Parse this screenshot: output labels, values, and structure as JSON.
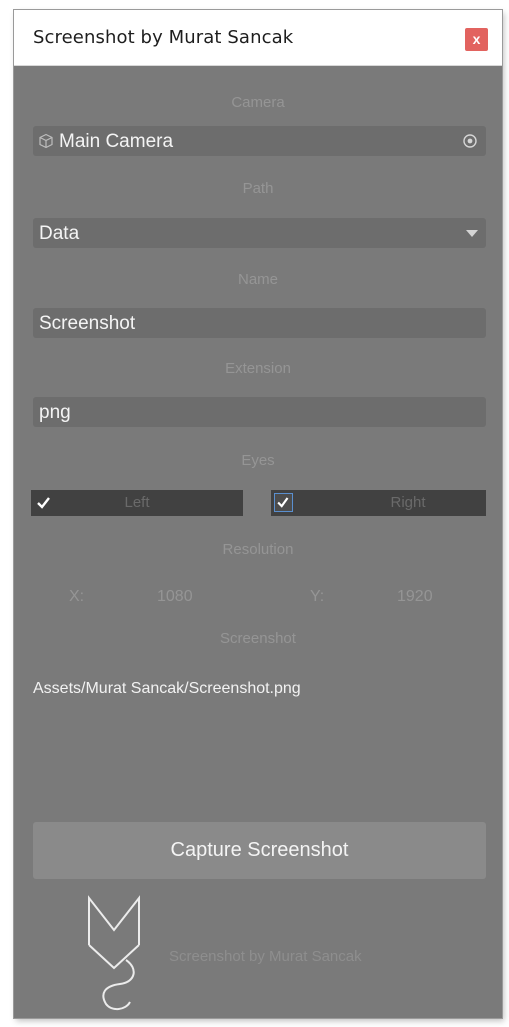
{
  "window": {
    "title": "Screenshot by Murat Sancak",
    "close_label": "x"
  },
  "camera": {
    "label": "Camera",
    "value": "Main Camera"
  },
  "path": {
    "label": "Path",
    "value": "Data"
  },
  "name": {
    "label": "Name",
    "value": "Screenshot"
  },
  "extension": {
    "label": "Extension",
    "value": "png"
  },
  "eyes": {
    "label": "Eyes",
    "left_label": "Left",
    "left_checked": true,
    "right_label": "Right",
    "right_checked": true
  },
  "resolution": {
    "label": "Resolution",
    "x_label": "X:",
    "x_value": "1080",
    "y_label": "Y:",
    "y_value": "1920"
  },
  "screenshot": {
    "label": "Screenshot",
    "path": "Assets/Murat Sancak/Screenshot.png"
  },
  "capture_button_label": "Capture Screenshot",
  "footer": {
    "logo_text": "Screenshot by Murat Sancak"
  },
  "colors": {
    "panel_bg": "#7a7a7a",
    "close_bg": "#e2635f",
    "checkbox_accent": "#5a8fcf"
  }
}
